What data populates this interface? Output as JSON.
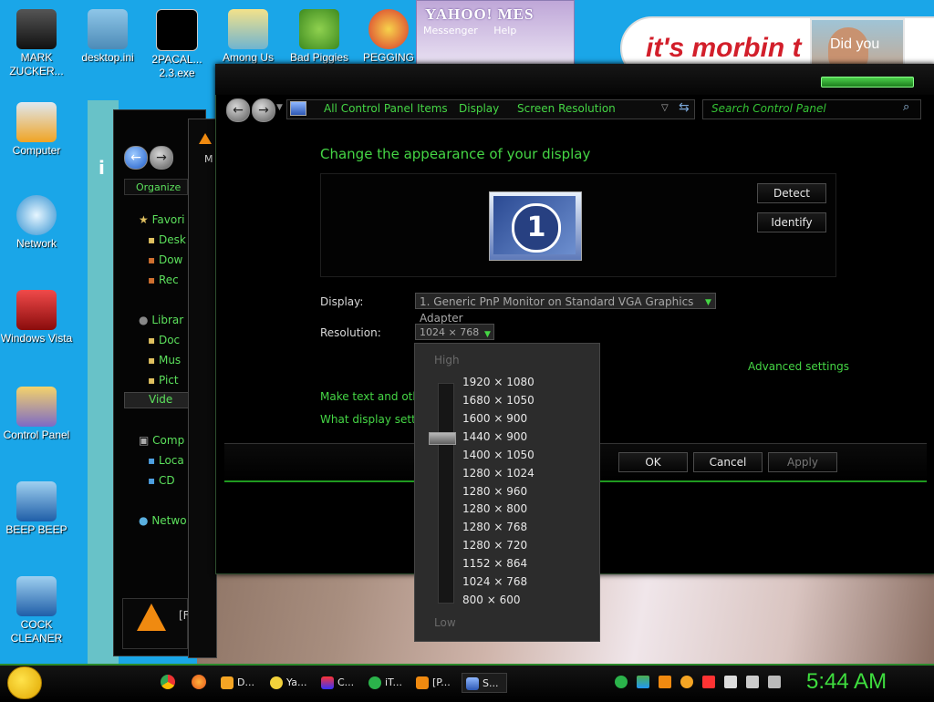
{
  "desktop": {
    "icons": [
      {
        "label": "MARK ZUCKER..."
      },
      {
        "label": "desktop.ini"
      },
      {
        "label": "2PACAL... 2.3.exe"
      },
      {
        "label": "Among Us"
      },
      {
        "label": "Bad Piggies"
      },
      {
        "label": "PEGGING"
      },
      {
        "label": "Computer"
      },
      {
        "label": "Network"
      },
      {
        "label": "Windows Vista"
      },
      {
        "label": "Control Panel"
      },
      {
        "label": "BEEP BEEP"
      },
      {
        "label": "COCK CLEANER"
      }
    ],
    "banner_text": "it's morbin t",
    "photo_text": "Did you"
  },
  "yahoo": {
    "logo": "YAHOO! MES",
    "menu_messenger": "Messenger",
    "menu_help": "Help"
  },
  "explorer": {
    "organize": "Organize",
    "nav": [
      {
        "label": "Favori"
      },
      {
        "label": "Desk"
      },
      {
        "label": "Dow"
      },
      {
        "label": "Rec"
      },
      {
        "label": "Librar"
      },
      {
        "label": "Doc"
      },
      {
        "label": "Mus"
      },
      {
        "label": "Pict"
      },
      {
        "label": "Vide"
      },
      {
        "label": "Comp"
      },
      {
        "label": "Loca"
      },
      {
        "label": "CD"
      },
      {
        "label": "Netwo"
      }
    ],
    "tab_m": "M",
    "vlc_label": "[F"
  },
  "control_panel": {
    "breadcrumb": [
      "All Control Panel Items",
      "Display",
      "Screen Resolution"
    ],
    "search_placeholder": "Search Control Panel",
    "title": "Change the appearance of your display",
    "monitor_number": "1",
    "detect": "Detect",
    "identify": "Identify",
    "display_label": "Display:",
    "display_value": "1. Generic PnP Monitor on Standard VGA Graphics Adapter",
    "resolution_label": "Resolution:",
    "resolution_value": "1024 × 768",
    "advanced": "Advanced settings",
    "make_text": "Make text and other",
    "what_settings": "What display setting",
    "ok": "OK",
    "cancel": "Cancel",
    "apply": "Apply"
  },
  "resolution_dropdown": {
    "high": "High",
    "low": "Low",
    "options": [
      "1920 × 1080",
      "1680 × 1050",
      "1600 × 900",
      "1440 × 900",
      "1400 × 1050",
      "1280 × 1024",
      "1280 × 960",
      "1280 × 800",
      "1280 × 768",
      "1280 × 720",
      "1152 × 864",
      "1024 × 768",
      "800 × 600"
    ]
  },
  "taskbar": {
    "items": [
      {
        "label": "D..."
      },
      {
        "label": "Ya..."
      },
      {
        "label": "C..."
      },
      {
        "label": "iT..."
      },
      {
        "label": "[P..."
      },
      {
        "label": "S..."
      }
    ],
    "clock": "5:44 AM"
  },
  "colors": {
    "accent_green": "#45d645",
    "desktop_blue": "#1aa6e8",
    "banner_red": "#d21e2a"
  }
}
